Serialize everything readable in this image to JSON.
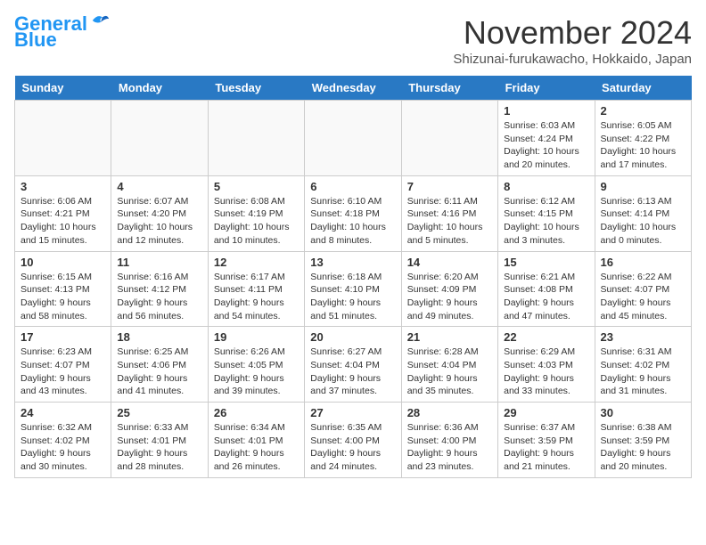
{
  "header": {
    "logo_line1": "General",
    "logo_line2": "Blue",
    "month": "November 2024",
    "location": "Shizunai-furukawacho, Hokkaido, Japan"
  },
  "weekdays": [
    "Sunday",
    "Monday",
    "Tuesday",
    "Wednesday",
    "Thursday",
    "Friday",
    "Saturday"
  ],
  "weeks": [
    [
      {
        "day": "",
        "info": ""
      },
      {
        "day": "",
        "info": ""
      },
      {
        "day": "",
        "info": ""
      },
      {
        "day": "",
        "info": ""
      },
      {
        "day": "",
        "info": ""
      },
      {
        "day": "1",
        "info": "Sunrise: 6:03 AM\nSunset: 4:24 PM\nDaylight: 10 hours\nand 20 minutes."
      },
      {
        "day": "2",
        "info": "Sunrise: 6:05 AM\nSunset: 4:22 PM\nDaylight: 10 hours\nand 17 minutes."
      }
    ],
    [
      {
        "day": "3",
        "info": "Sunrise: 6:06 AM\nSunset: 4:21 PM\nDaylight: 10 hours\nand 15 minutes."
      },
      {
        "day": "4",
        "info": "Sunrise: 6:07 AM\nSunset: 4:20 PM\nDaylight: 10 hours\nand 12 minutes."
      },
      {
        "day": "5",
        "info": "Sunrise: 6:08 AM\nSunset: 4:19 PM\nDaylight: 10 hours\nand 10 minutes."
      },
      {
        "day": "6",
        "info": "Sunrise: 6:10 AM\nSunset: 4:18 PM\nDaylight: 10 hours\nand 8 minutes."
      },
      {
        "day": "7",
        "info": "Sunrise: 6:11 AM\nSunset: 4:16 PM\nDaylight: 10 hours\nand 5 minutes."
      },
      {
        "day": "8",
        "info": "Sunrise: 6:12 AM\nSunset: 4:15 PM\nDaylight: 10 hours\nand 3 minutes."
      },
      {
        "day": "9",
        "info": "Sunrise: 6:13 AM\nSunset: 4:14 PM\nDaylight: 10 hours\nand 0 minutes."
      }
    ],
    [
      {
        "day": "10",
        "info": "Sunrise: 6:15 AM\nSunset: 4:13 PM\nDaylight: 9 hours\nand 58 minutes."
      },
      {
        "day": "11",
        "info": "Sunrise: 6:16 AM\nSunset: 4:12 PM\nDaylight: 9 hours\nand 56 minutes."
      },
      {
        "day": "12",
        "info": "Sunrise: 6:17 AM\nSunset: 4:11 PM\nDaylight: 9 hours\nand 54 minutes."
      },
      {
        "day": "13",
        "info": "Sunrise: 6:18 AM\nSunset: 4:10 PM\nDaylight: 9 hours\nand 51 minutes."
      },
      {
        "day": "14",
        "info": "Sunrise: 6:20 AM\nSunset: 4:09 PM\nDaylight: 9 hours\nand 49 minutes."
      },
      {
        "day": "15",
        "info": "Sunrise: 6:21 AM\nSunset: 4:08 PM\nDaylight: 9 hours\nand 47 minutes."
      },
      {
        "day": "16",
        "info": "Sunrise: 6:22 AM\nSunset: 4:07 PM\nDaylight: 9 hours\nand 45 minutes."
      }
    ],
    [
      {
        "day": "17",
        "info": "Sunrise: 6:23 AM\nSunset: 4:07 PM\nDaylight: 9 hours\nand 43 minutes."
      },
      {
        "day": "18",
        "info": "Sunrise: 6:25 AM\nSunset: 4:06 PM\nDaylight: 9 hours\nand 41 minutes."
      },
      {
        "day": "19",
        "info": "Sunrise: 6:26 AM\nSunset: 4:05 PM\nDaylight: 9 hours\nand 39 minutes."
      },
      {
        "day": "20",
        "info": "Sunrise: 6:27 AM\nSunset: 4:04 PM\nDaylight: 9 hours\nand 37 minutes."
      },
      {
        "day": "21",
        "info": "Sunrise: 6:28 AM\nSunset: 4:04 PM\nDaylight: 9 hours\nand 35 minutes."
      },
      {
        "day": "22",
        "info": "Sunrise: 6:29 AM\nSunset: 4:03 PM\nDaylight: 9 hours\nand 33 minutes."
      },
      {
        "day": "23",
        "info": "Sunrise: 6:31 AM\nSunset: 4:02 PM\nDaylight: 9 hours\nand 31 minutes."
      }
    ],
    [
      {
        "day": "24",
        "info": "Sunrise: 6:32 AM\nSunset: 4:02 PM\nDaylight: 9 hours\nand 30 minutes."
      },
      {
        "day": "25",
        "info": "Sunrise: 6:33 AM\nSunset: 4:01 PM\nDaylight: 9 hours\nand 28 minutes."
      },
      {
        "day": "26",
        "info": "Sunrise: 6:34 AM\nSunset: 4:01 PM\nDaylight: 9 hours\nand 26 minutes."
      },
      {
        "day": "27",
        "info": "Sunrise: 6:35 AM\nSunset: 4:00 PM\nDaylight: 9 hours\nand 24 minutes."
      },
      {
        "day": "28",
        "info": "Sunrise: 6:36 AM\nSunset: 4:00 PM\nDaylight: 9 hours\nand 23 minutes."
      },
      {
        "day": "29",
        "info": "Sunrise: 6:37 AM\nSunset: 3:59 PM\nDaylight: 9 hours\nand 21 minutes."
      },
      {
        "day": "30",
        "info": "Sunrise: 6:38 AM\nSunset: 3:59 PM\nDaylight: 9 hours\nand 20 minutes."
      }
    ]
  ]
}
